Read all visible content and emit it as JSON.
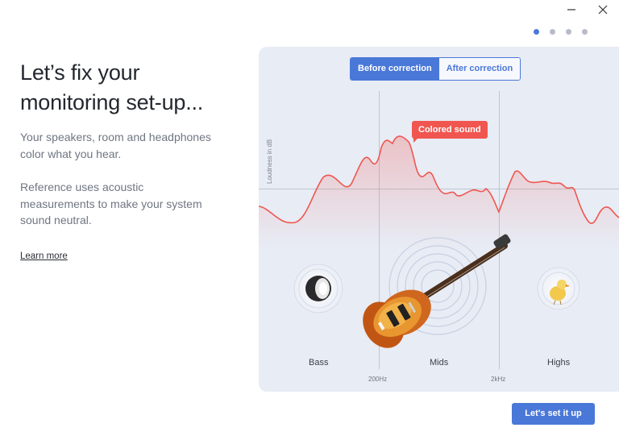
{
  "window": {
    "minimize_icon": "minimize-icon",
    "close_icon": "close-icon"
  },
  "pagination": {
    "total": 4,
    "active": 0
  },
  "intro": {
    "title_line1": "Let’s fix your",
    "title_line2": "monitoring set-up...",
    "paragraph1": "Your speakers, room and headphones color what you hear.",
    "paragraph2": "Reference uses acoustic measurements to make your system sound neutral.",
    "learn_more": "Learn more"
  },
  "visual": {
    "toggle": {
      "before": "Before correction",
      "after": "After correction",
      "selected": "before"
    },
    "y_axis_label": "Loudness in dB",
    "callout": "Colored sound",
    "bands": [
      "Bass",
      "Mids",
      "Highs"
    ],
    "freq_marks": [
      "200Hz",
      "2kHz"
    ],
    "colors": {
      "accent": "#4a78d8",
      "curve": "#f0564f",
      "panel": "#e8ecf5"
    }
  },
  "cta": {
    "label": "Let's set it up"
  }
}
